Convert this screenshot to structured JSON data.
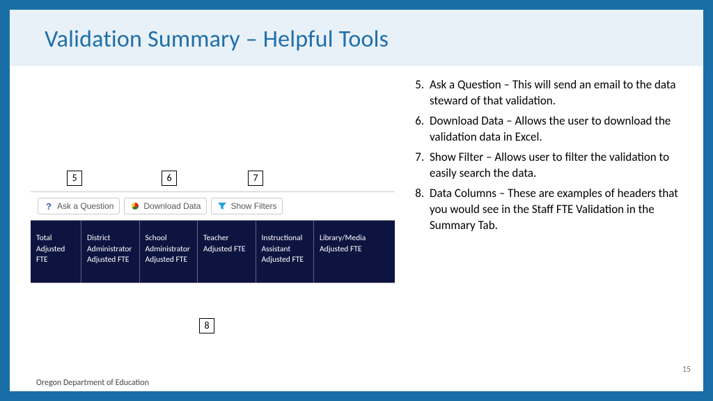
{
  "title": "Validation Summary – Helpful Tools",
  "callouts": {
    "c5": "5",
    "c6": "6",
    "c7": "7",
    "c8": "8"
  },
  "toolbar": {
    "ask_label": "Ask a Question",
    "download_label": "Download Data",
    "filter_label": "Show Filters"
  },
  "columns": [
    "Total Adjusted FTE",
    "District Administrator Adjusted FTE",
    "School Administrator Adjusted FTE",
    "Teacher Adjusted FTE",
    "Instructional Assistant Adjusted FTE",
    "Library/Media Adjusted FTE"
  ],
  "list_start": 5,
  "descriptions": [
    {
      "lead": "Ask a Question – ",
      "body": "This will send an email to the data steward of that validation."
    },
    {
      "lead": "Download Data – ",
      "body": "Allows the user to download the validation data in Excel."
    },
    {
      "lead": "Show Filter – ",
      "body": "Allows user to filter the validation to easily search the data."
    },
    {
      "lead": "Data Columns – ",
      "body": "These are examples of headers that you would see in the Staff FTE Validation in the Summary Tab."
    }
  ],
  "footer_org": "Oregon Department of Education",
  "page_number": "15"
}
